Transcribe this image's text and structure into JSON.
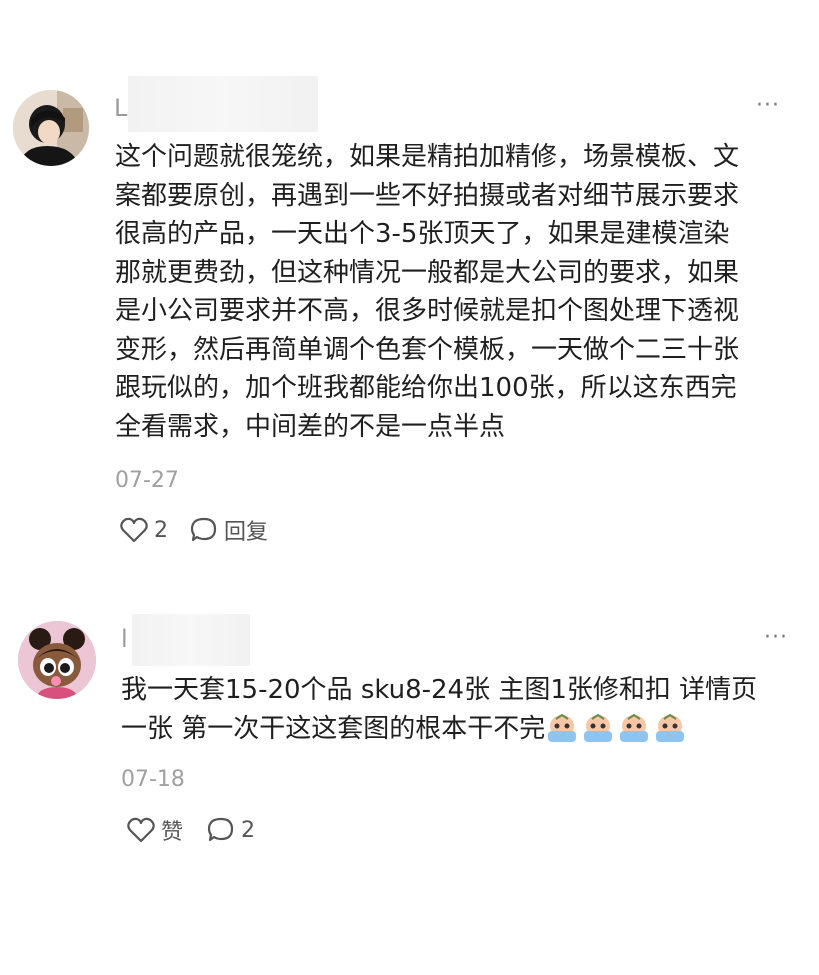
{
  "comments": [
    {
      "username_visible": "L",
      "more_label": "···",
      "text": "这个问题就很笼统，如果是精拍加精修，场景模板、文\n案都要原创，再遇到一些不好拍摄或者对细节展示要求\n很高的产品，一天出个3-5张顶天了，如果是建模渲染\n那就更费劲，但这种情况一般都是大公司的要求，如果\n是小公司要求并不高，很多时候就是扣个图处理下透视\n变形，然后再简单调个色套个模板，一天做个二三十张\n跟玩似的，加个班我都能给你出100张，所以这东西完\n全看需求，中间差的不是一点半点",
      "date": "07-27",
      "like_label": "2",
      "reply_label": "回复"
    },
    {
      "username_visible": "l",
      "more_label": "···",
      "text_line1": "我一天套15-20个品 sku8-24张 主图1张修和扣 详情页",
      "text_line2": "一张 第一次干这这套图的根本干不完",
      "date": "07-18",
      "like_label": "赞",
      "reply_label": "2"
    }
  ]
}
